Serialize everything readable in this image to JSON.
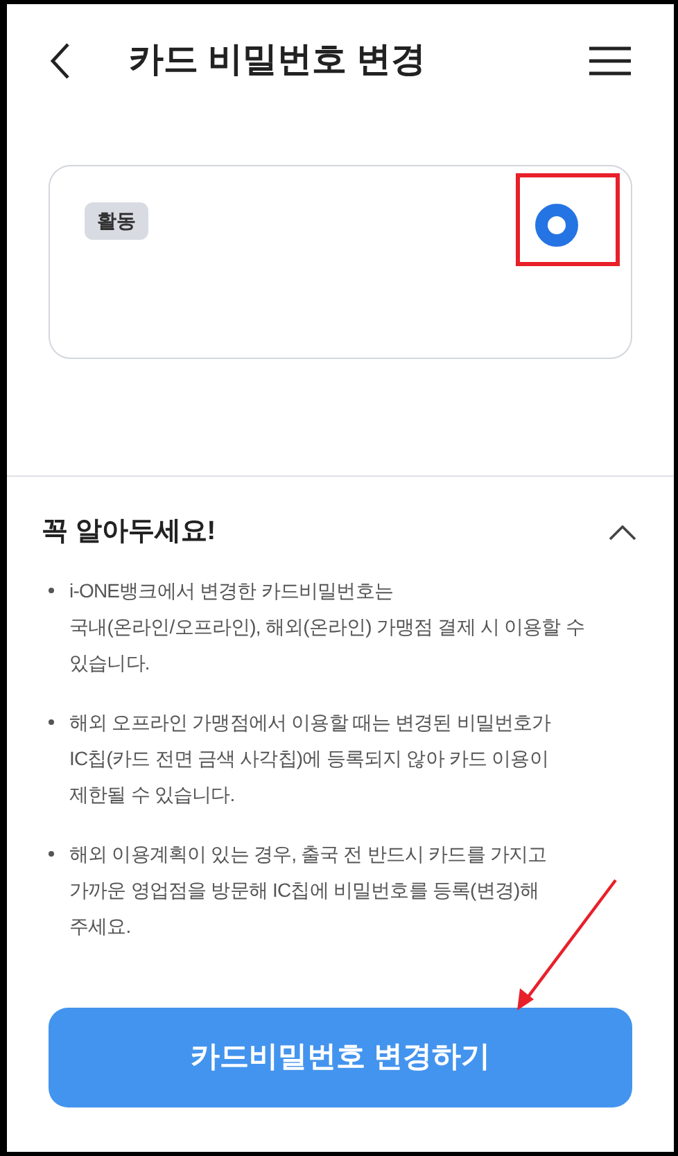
{
  "header": {
    "title": "카드 비밀번호 변경"
  },
  "cards": [
    {
      "badge": "활동",
      "selected": true
    }
  ],
  "notice": {
    "title": "꼭 알아두세요!",
    "expanded": true,
    "items": [
      "i-ONE뱅크에서 변경한 카드비밀번호는\n국내(온라인/오프라인), 해외(온라인) 가맹점 결제 시 이용할 수\n있습니다.",
      "해외 오프라인 가맹점에서 이용할 때는 변경된 비밀번호가\nIC칩(카드 전면 금색 사각칩)에 등록되지 않아 카드 이용이\n제한될 수 있습니다.",
      "해외 이용계획이 있는 경우, 출국 전 반드시 카드를 가지고\n가까운 영업점을 방문해 IC칩에 비밀번호를 등록(변경)해\n주세요."
    ]
  },
  "primary_button": "카드비밀번호 변경하기"
}
